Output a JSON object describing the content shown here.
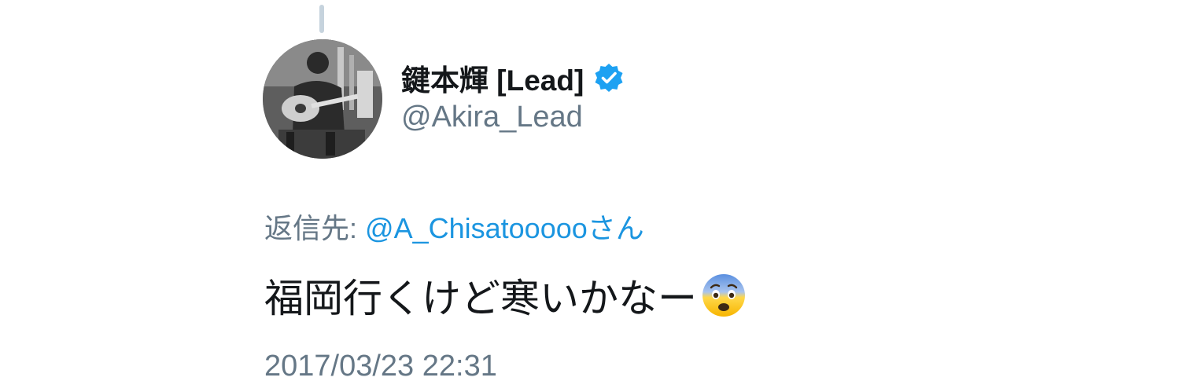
{
  "tweet": {
    "author": {
      "display_name": "鍵本輝 [Lead]",
      "handle": "@Akira_Lead",
      "verified": true,
      "avatar_icon": "profile-photo-guitarist-icon"
    },
    "reply_to": {
      "prefix": "返信先:",
      "mention": "@A_Chisatoooooさん"
    },
    "text": "福岡行くけど寒いかなー",
    "emoji": "fearful-face-icon",
    "timestamp": "2017/03/23 22:31"
  },
  "colors": {
    "primary_text": "#14171a",
    "secondary_text": "#657786",
    "link": "#1b95e0",
    "verified_badge": "#1da1f2",
    "thread_line": "#c6d3dd"
  }
}
